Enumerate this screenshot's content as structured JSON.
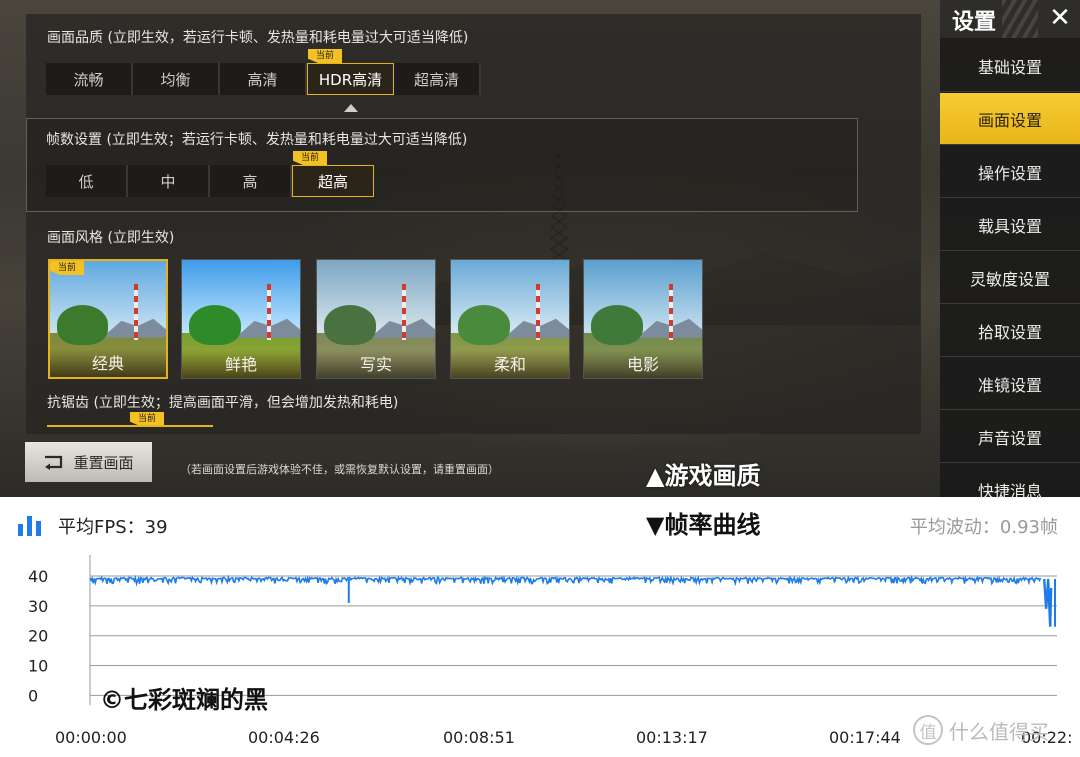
{
  "game": {
    "quality": {
      "label": "画面品质 (立即生效，若运行卡顿、发热量和耗电量过大可适当降低)",
      "options": [
        "流畅",
        "均衡",
        "高清",
        "HDR高清",
        "超高清"
      ],
      "selected": "HDR高清"
    },
    "fps": {
      "label": "帧数设置 (立即生效；若运行卡顿、发热量和耗电量过大可适当降低)",
      "options": [
        "低",
        "中",
        "高",
        "超高"
      ],
      "selected": "超高"
    },
    "style": {
      "label": "画面风格 (立即生效)",
      "options": [
        "经典",
        "鲜艳",
        "写实",
        "柔和",
        "电影"
      ],
      "selected": "经典"
    },
    "antialias": {
      "label": "抗锯齿 (立即生效；提高画面平滑，但会增加发热和耗电)"
    },
    "current_badge": "当前",
    "reset_button": "重置画面",
    "reset_hint": "（若画面设置后游戏体验不佳，或需恢复默认设置，请重置画面）",
    "caption": "▲游戏画质",
    "sidebar": {
      "title": "设置",
      "close": "✕",
      "items": [
        "基础设置",
        "画面设置",
        "操作设置",
        "载具设置",
        "灵敏度设置",
        "拾取设置",
        "准镜设置",
        "声音设置",
        "快捷消息"
      ],
      "active": "画面设置"
    }
  },
  "stats": {
    "avg_fps": "平均FPS：39",
    "caption": "▼帧率曲线",
    "avg_wave": "平均波动：0.93帧",
    "watermark": "©七彩斑斓的黑",
    "site_logo": "什么值得买"
  },
  "colors": {
    "accent": "#e3b21f",
    "line": "#1f7be8"
  },
  "chart_data": {
    "type": "line",
    "title": "",
    "xlabel": "",
    "ylabel": "",
    "ylim": [
      0,
      40
    ],
    "yticks": [
      40,
      30,
      20,
      10,
      0
    ],
    "xticks": [
      "00:00:00",
      "00:04:26",
      "00:08:51",
      "00:13:17",
      "00:17:44",
      "00:22:"
    ],
    "series": [
      {
        "x": [
          "00:00:00",
          "00:04:26",
          "00:05:54",
          "00:08:51",
          "00:13:17",
          "00:17:44",
          "00:22:00"
        ],
        "y": [
          39,
          39,
          31,
          39,
          39,
          39,
          23
        ]
      }
    ]
  }
}
